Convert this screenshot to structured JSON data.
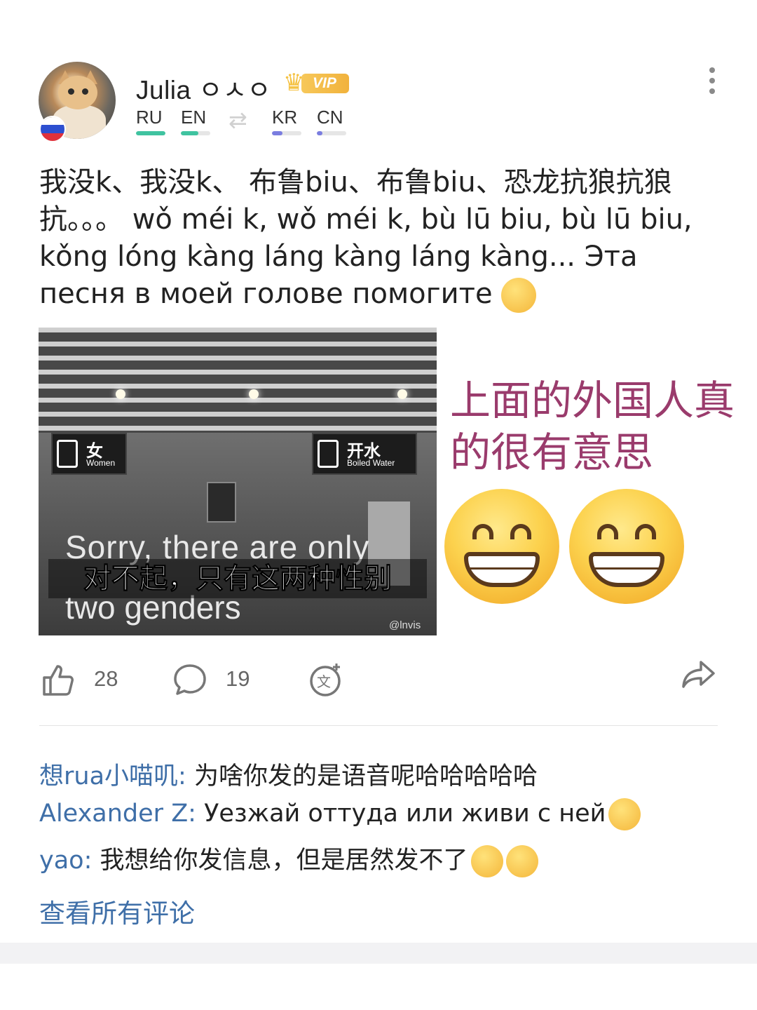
{
  "post": {
    "author": {
      "name": "Julia ㅇㅅㅇ",
      "badge": "VIP",
      "flag_colors": [
        "#ffffff",
        "#2d4fd0",
        "#e0313b"
      ]
    },
    "languages": {
      "native": [
        {
          "code": "RU",
          "level": 1.0,
          "color": "#3fc3a0"
        },
        {
          "code": "EN",
          "level": 0.6,
          "color": "#3fc3a0"
        }
      ],
      "swap_icon": "swap-arrows-icon",
      "learning": [
        {
          "code": "KR",
          "level": 0.35,
          "color": "#7a7de0"
        },
        {
          "code": "CN",
          "level": 0.2,
          "color": "#7a7de0"
        }
      ]
    },
    "text": "我没k、我没k、 布鲁biu、布鲁biu、恐龙抗狼抗狼抗。。。 wǒ méi k, wǒ méi k, bù lū biu, bù lū biu, kǒng lóng kàng láng kàng láng kàng... Эта песня в моей голове помогите",
    "text_emoji": "crying-face-emoji",
    "image": {
      "sign_left_zh": "女",
      "sign_left_en": "Women",
      "sign_right_zh": "开水",
      "sign_right_en": "Boiled Water",
      "subtitle_en_1": "Sorry, there are only",
      "subtitle_zh": "对不起，只有这两种性别",
      "subtitle_en_2": "two genders",
      "watermark": "@lnvis",
      "caption": "上面的外国人真的很有意思",
      "emoji": "grinning-face-emoji"
    },
    "actions": {
      "likes": "28",
      "comments": "19"
    },
    "comments": [
      {
        "author": "想rua小喵叽:",
        "text": " 为啥你发的是语音呢哈哈哈哈哈"
      },
      {
        "author": "Alexander Z:",
        "text": " Уезжай оттуда или живи с ней",
        "emoji": "laughing-tears-emoji"
      },
      {
        "author": "yao:",
        "text": " 我想给你发信息，但是居然发不了",
        "emoji": "crying-face-emoji"
      }
    ],
    "view_all": "查看所有评论"
  },
  "colors": {
    "link": "#3f6fa8",
    "caption": "#9a3b6c",
    "native_bar": "#3fc3a0",
    "learning_bar": "#7a7de0"
  }
}
